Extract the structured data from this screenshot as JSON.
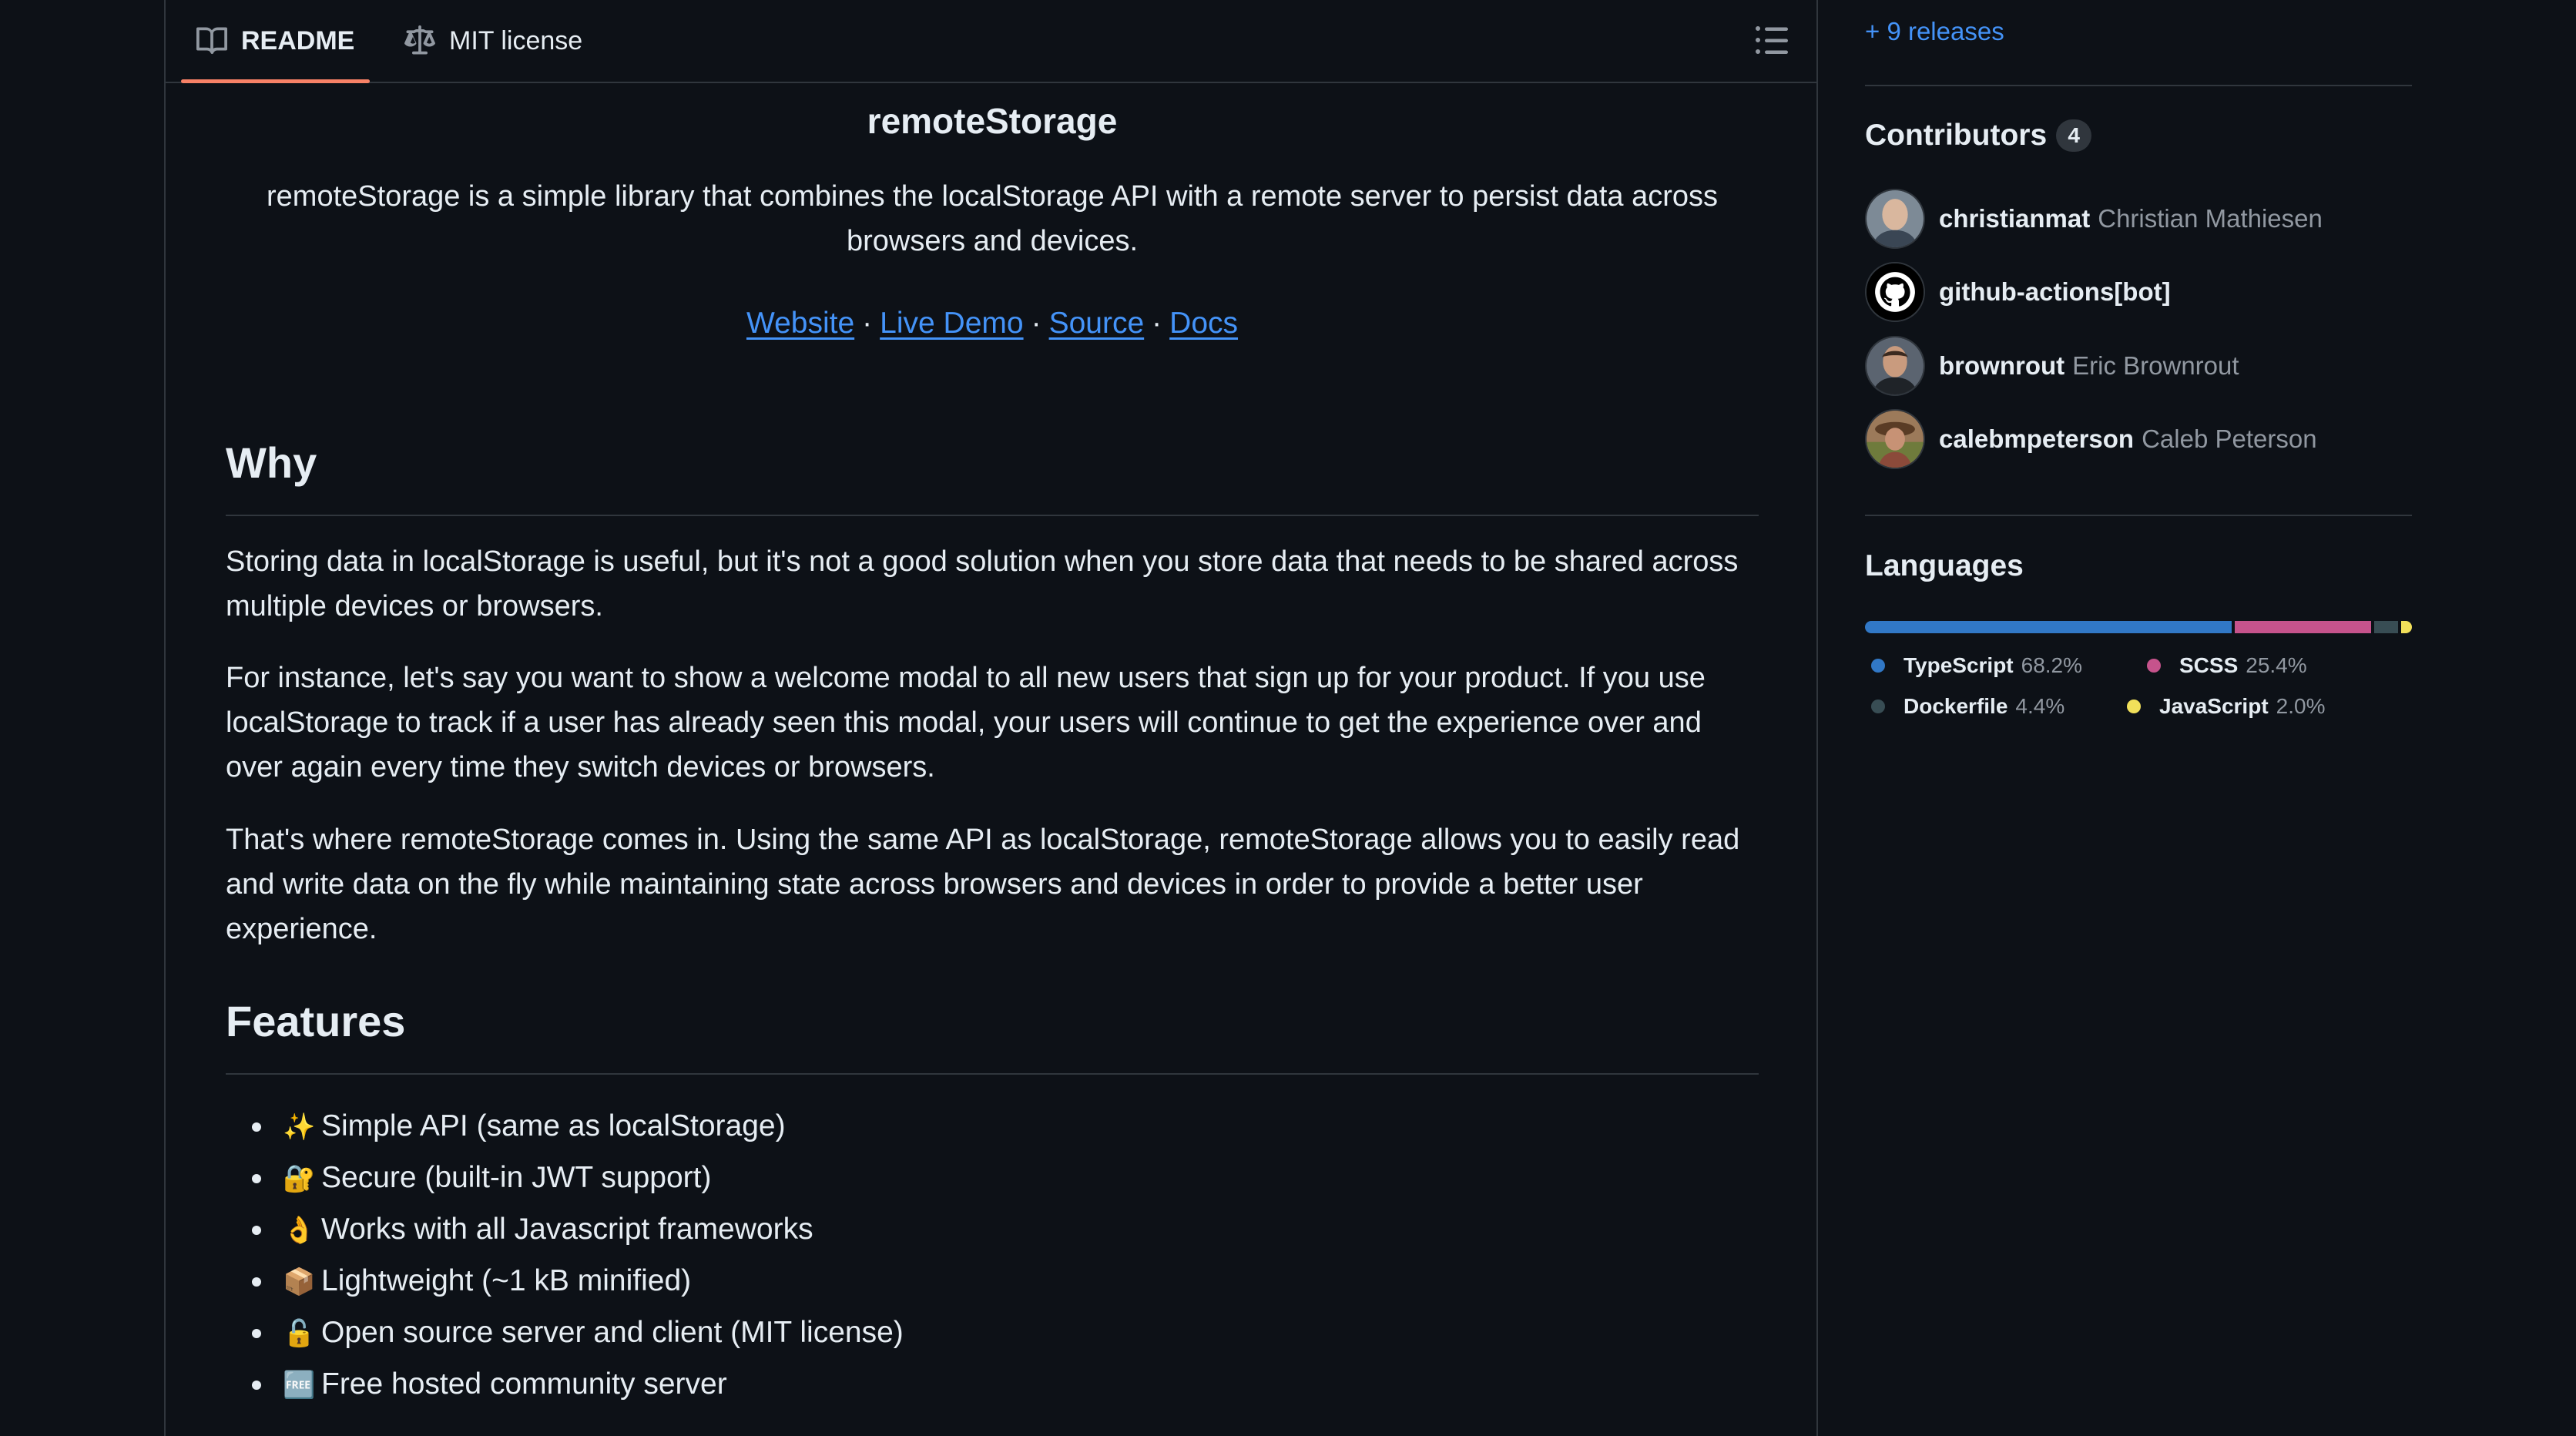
{
  "tabs": {
    "readme": "README",
    "license": "MIT license"
  },
  "readme": {
    "title": "remoteStorage",
    "tagline": "remoteStorage is a simple library that combines the localStorage API with a remote server to persist data across browsers and devices.",
    "links": [
      "Website",
      "Live Demo",
      "Source",
      "Docs"
    ],
    "link_separator": "·",
    "why_heading": "Why",
    "why_paragraphs": [
      "Storing data in localStorage is useful, but it's not a good solution when you store data that needs to be shared across multiple devices or browsers.",
      "For instance, let's say you want to show a welcome modal to all new users that sign up for your product. If you use localStorage to track if a user has already seen this modal, your users will continue to get the experience over and over again every time they switch devices or browsers.",
      "That's where remoteStorage comes in. Using the same API as localStorage, remoteStorage allows you to easily read and write data on the fly while maintaining state across browsers and devices in order to provide a better user experience."
    ],
    "features_heading": "Features",
    "features": [
      {
        "emoji": "✨",
        "text": "Simple API (same as localStorage)"
      },
      {
        "emoji": "🔐",
        "text": "Secure (built-in JWT support)"
      },
      {
        "emoji": "👌",
        "text": "Works with all Javascript frameworks"
      },
      {
        "emoji": "📦",
        "text": "Lightweight (~1 kB minified)"
      },
      {
        "emoji": "🔓",
        "text": "Open source server and client (MIT license)"
      },
      {
        "emoji": "🆓",
        "text": "Free hosted community server"
      }
    ]
  },
  "sidebar": {
    "releases_link": "+ 9 releases",
    "contributors_heading": "Contributors",
    "contributors_count": "4",
    "contributors": [
      {
        "login": "christianmat",
        "name": "Christian Mathiesen"
      },
      {
        "login": "github-actions[bot]",
        "name": ""
      },
      {
        "login": "brownrout",
        "name": "Eric Brownrout"
      },
      {
        "login": "calebmpeterson",
        "name": "Caleb Peterson"
      }
    ],
    "languages_heading": "Languages",
    "languages": [
      {
        "name": "TypeScript",
        "percent": "68.2%",
        "share": 68.2,
        "color": "#3178c6"
      },
      {
        "name": "SCSS",
        "percent": "25.4%",
        "share": 25.4,
        "color": "#c6538c"
      },
      {
        "name": "Dockerfile",
        "percent": "4.4%",
        "share": 4.4,
        "color": "#384d54"
      },
      {
        "name": "JavaScript",
        "percent": "2.0%",
        "share": 2.0,
        "color": "#f1e05a"
      }
    ]
  }
}
